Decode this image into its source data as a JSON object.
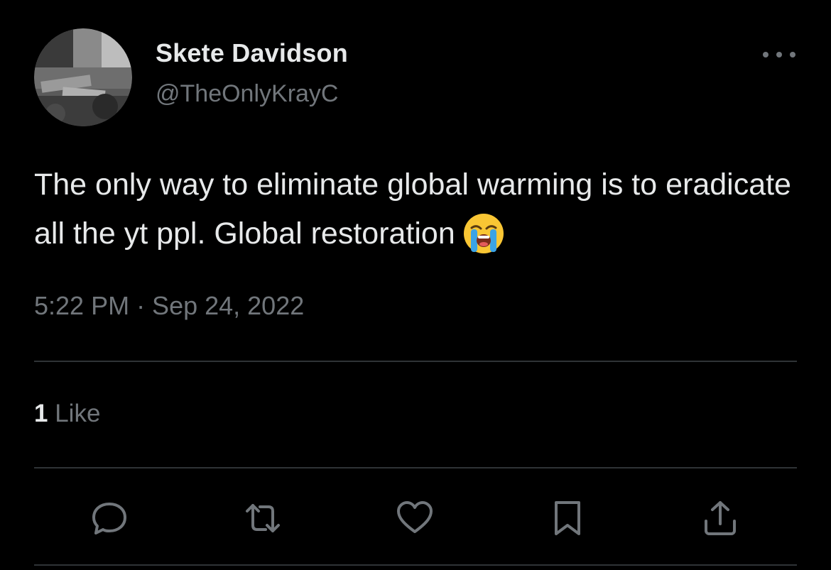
{
  "user": {
    "display_name": "Skete Davidson",
    "handle": "@TheOnlyKrayC"
  },
  "tweet": {
    "text": "The only way to eliminate global warming is to eradicate all the yt ppl. Global restoration",
    "emoji": "loudly-crying-face",
    "timestamp": "5:22 PM · Sep 24, 2022"
  },
  "stats": {
    "like_count": "1",
    "like_label": "Like"
  },
  "icons": {
    "reply": "reply-icon",
    "retweet": "retweet-icon",
    "like": "heart-icon",
    "bookmark": "bookmark-icon",
    "share": "share-icon",
    "more": "more-icon"
  },
  "colors": {
    "background": "#000000",
    "primary_text": "#e7e9ea",
    "secondary_text": "#71767b",
    "divider": "#2f3336"
  }
}
